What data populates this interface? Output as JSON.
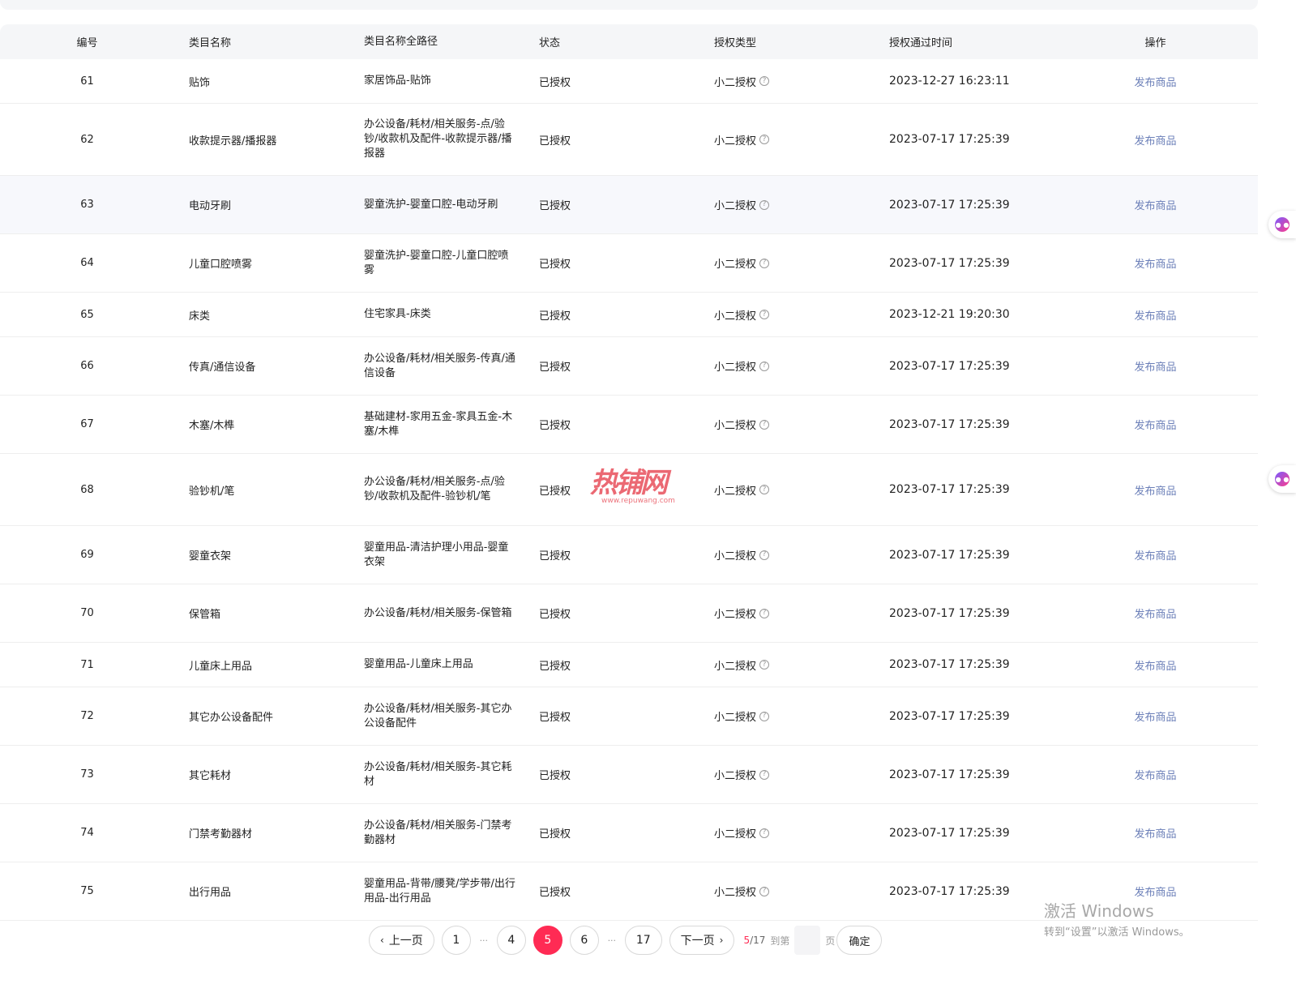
{
  "headers": {
    "no": "编号",
    "name": "类目名称",
    "path": "类目名称全路径",
    "status": "状态",
    "type": "授权类型",
    "time": "授权通过时间",
    "op": "操作"
  },
  "rows": [
    {
      "no": "61",
      "name": "贴饰",
      "path": "家居饰品-贴饰",
      "status": "已授权",
      "type": "小二授权",
      "time": "2023-12-27 16:23:11",
      "op": "发布商品"
    },
    {
      "no": "62",
      "name": "收款提示器/播报器",
      "path": "办公设备/耗材/相关服务-点/验钞/收款机及配件-收款提示器/播报器",
      "status": "已授权",
      "type": "小二授权",
      "time": "2023-07-17 17:25:39",
      "op": "发布商品"
    },
    {
      "no": "63",
      "name": "电动牙刷",
      "path": "婴童洗护-婴童口腔-电动牙刷",
      "status": "已授权",
      "type": "小二授权",
      "time": "2023-07-17 17:25:39",
      "op": "发布商品"
    },
    {
      "no": "64",
      "name": "儿童口腔喷雾",
      "path": "婴童洗护-婴童口腔-儿童口腔喷雾",
      "status": "已授权",
      "type": "小二授权",
      "time": "2023-07-17 17:25:39",
      "op": "发布商品"
    },
    {
      "no": "65",
      "name": "床类",
      "path": "住宅家具-床类",
      "status": "已授权",
      "type": "小二授权",
      "time": "2023-12-21 19:20:30",
      "op": "发布商品"
    },
    {
      "no": "66",
      "name": "传真/通信设备",
      "path": "办公设备/耗材/相关服务-传真/通信设备",
      "status": "已授权",
      "type": "小二授权",
      "time": "2023-07-17 17:25:39",
      "op": "发布商品"
    },
    {
      "no": "67",
      "name": "木塞/木榫",
      "path": "基础建材-家用五金-家具五金-木塞/木榫",
      "status": "已授权",
      "type": "小二授权",
      "time": "2023-07-17 17:25:39",
      "op": "发布商品"
    },
    {
      "no": "68",
      "name": "验钞机/笔",
      "path": "办公设备/耗材/相关服务-点/验钞/收款机及配件-验钞机/笔",
      "status": "已授权",
      "type": "小二授权",
      "time": "2023-07-17 17:25:39",
      "op": "发布商品"
    },
    {
      "no": "69",
      "name": "婴童衣架",
      "path": "婴童用品-清洁护理小用品-婴童衣架",
      "status": "已授权",
      "type": "小二授权",
      "time": "2023-07-17 17:25:39",
      "op": "发布商品"
    },
    {
      "no": "70",
      "name": "保管箱",
      "path": "办公设备/耗材/相关服务-保管箱",
      "status": "已授权",
      "type": "小二授权",
      "time": "2023-07-17 17:25:39",
      "op": "发布商品"
    },
    {
      "no": "71",
      "name": "儿童床上用品",
      "path": "婴童用品-儿童床上用品",
      "status": "已授权",
      "type": "小二授权",
      "time": "2023-07-17 17:25:39",
      "op": "发布商品"
    },
    {
      "no": "72",
      "name": "其它办公设备配件",
      "path": "办公设备/耗材/相关服务-其它办公设备配件",
      "status": "已授权",
      "type": "小二授权",
      "time": "2023-07-17 17:25:39",
      "op": "发布商品"
    },
    {
      "no": "73",
      "name": "其它耗材",
      "path": "办公设备/耗材/相关服务-其它耗材",
      "status": "已授权",
      "type": "小二授权",
      "time": "2023-07-17 17:25:39",
      "op": "发布商品"
    },
    {
      "no": "74",
      "name": "门禁考勤器材",
      "path": "办公设备/耗材/相关服务-门禁考勤器材",
      "status": "已授权",
      "type": "小二授权",
      "time": "2023-07-17 17:25:39",
      "op": "发布商品"
    },
    {
      "no": "75",
      "name": "出行用品",
      "path": "婴童用品-背带/腰凳/学步带/出行用品-出行用品",
      "status": "已授权",
      "type": "小二授权",
      "time": "2023-07-17 17:25:39",
      "op": "发布商品"
    }
  ],
  "pagination": {
    "prev": "上一页",
    "next": "下一页",
    "pages": [
      "1",
      "4",
      "5",
      "6",
      "17"
    ],
    "current": "5",
    "total": "/17",
    "goto_label": "到第",
    "unit": "页",
    "confirm": "确定",
    "ellipsis": "···"
  },
  "watermark": {
    "main": "热铺网",
    "sub": "www.repuwang.com"
  },
  "activation": {
    "line1": "激活 Windows",
    "line2": "转到“设置”以激活 Windows。"
  },
  "colors": {
    "accent": "#ff2b54",
    "link": "#6b7fb8",
    "header_bg": "#f5f6f8"
  },
  "icons": {
    "help": "question-circle-icon",
    "prev": "chevron-left-icon",
    "next": "chevron-right-icon"
  }
}
